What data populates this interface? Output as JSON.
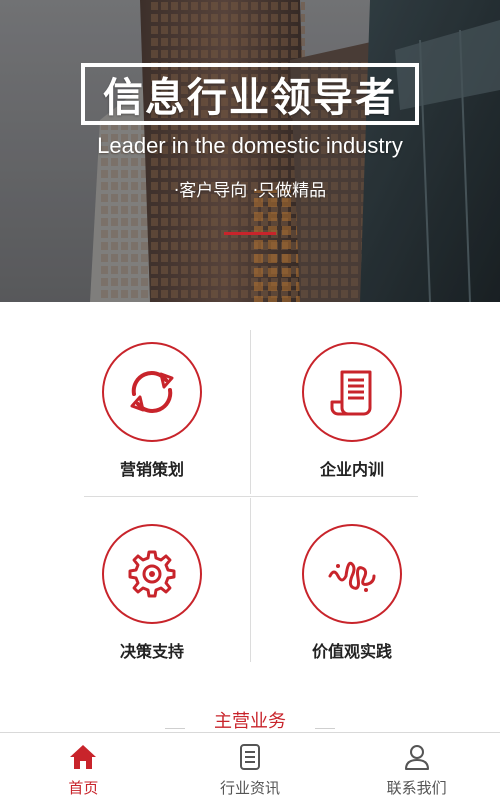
{
  "colors": {
    "accent": "#c8242b",
    "text": "#222222",
    "muted": "#555555"
  },
  "hero": {
    "title": "信息行业领导者",
    "subtitle": "Leader in the domestic industry",
    "slogan": "·客户导向 ·只做精品"
  },
  "services": [
    {
      "label": "营销策划",
      "icon": "refresh-icon"
    },
    {
      "label": "企业内训",
      "icon": "document-icon"
    },
    {
      "label": "决策支持",
      "icon": "gear-icon"
    },
    {
      "label": "价值观实践",
      "icon": "waveform-icon"
    }
  ],
  "section": {
    "title": "主营业务"
  },
  "tabbar": {
    "items": [
      {
        "label": "首页",
        "icon": "home-icon",
        "active": true
      },
      {
        "label": "行业资讯",
        "icon": "news-icon",
        "active": false
      },
      {
        "label": "联系我们",
        "icon": "user-icon",
        "active": false
      }
    ]
  }
}
